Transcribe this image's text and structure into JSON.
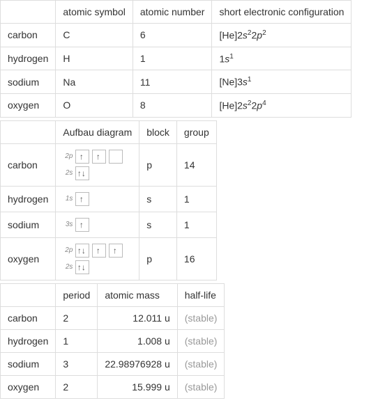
{
  "table1": {
    "headers": [
      "",
      "atomic symbol",
      "atomic number",
      "short electronic configuration"
    ],
    "rows": [
      {
        "name": "carbon",
        "symbol": "C",
        "number": "6",
        "config": {
          "prefix": "[He]",
          "terms": [
            [
              "2",
              "s",
              "2"
            ],
            [
              "2",
              "p",
              "2"
            ]
          ]
        }
      },
      {
        "name": "hydrogen",
        "symbol": "H",
        "number": "1",
        "config": {
          "prefix": "",
          "terms": [
            [
              "1",
              "s",
              "1"
            ]
          ]
        }
      },
      {
        "name": "sodium",
        "symbol": "Na",
        "number": "11",
        "config": {
          "prefix": "[Ne]",
          "terms": [
            [
              "3",
              "s",
              "1"
            ]
          ]
        }
      },
      {
        "name": "oxygen",
        "symbol": "O",
        "number": "8",
        "config": {
          "prefix": "[He]",
          "terms": [
            [
              "2",
              "s",
              "2"
            ],
            [
              "2",
              "p",
              "4"
            ]
          ]
        }
      }
    ]
  },
  "table2": {
    "headers": [
      "",
      "Aufbau diagram",
      "block",
      "group"
    ],
    "rows": [
      {
        "name": "carbon",
        "block": "p",
        "group": "14",
        "aufbau": [
          {
            "label": "2p",
            "boxes": [
              [
                "up"
              ],
              [
                "up"
              ],
              []
            ]
          },
          {
            "label": "2s",
            "boxes": [
              [
                "up",
                "down"
              ]
            ]
          }
        ]
      },
      {
        "name": "hydrogen",
        "block": "s",
        "group": "1",
        "aufbau": [
          {
            "label": "1s",
            "boxes": [
              [
                "up"
              ]
            ]
          }
        ]
      },
      {
        "name": "sodium",
        "block": "s",
        "group": "1",
        "aufbau": [
          {
            "label": "3s",
            "boxes": [
              [
                "up"
              ]
            ]
          }
        ]
      },
      {
        "name": "oxygen",
        "block": "p",
        "group": "16",
        "aufbau": [
          {
            "label": "2p",
            "boxes": [
              [
                "up",
                "down"
              ],
              [
                "up"
              ],
              [
                "up"
              ]
            ]
          },
          {
            "label": "2s",
            "boxes": [
              [
                "up",
                "down"
              ]
            ]
          }
        ]
      }
    ]
  },
  "table3": {
    "headers": [
      "",
      "period",
      "atomic mass",
      "half-life"
    ],
    "rows": [
      {
        "name": "carbon",
        "period": "2",
        "mass": "12.011 u",
        "half": "(stable)"
      },
      {
        "name": "hydrogen",
        "period": "1",
        "mass": "1.008 u",
        "half": "(stable)"
      },
      {
        "name": "sodium",
        "period": "3",
        "mass": "22.98976928 u",
        "half": "(stable)"
      },
      {
        "name": "oxygen",
        "period": "2",
        "mass": "15.999 u",
        "half": "(stable)"
      }
    ]
  }
}
